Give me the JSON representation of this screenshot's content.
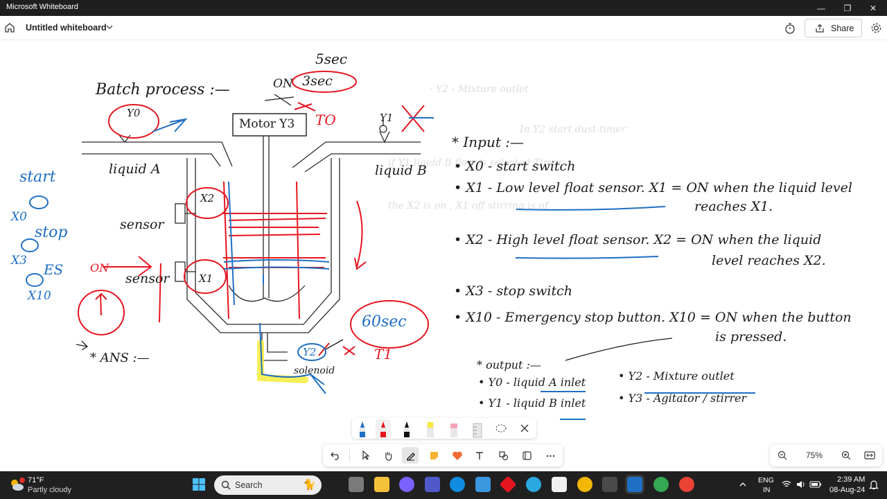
{
  "window": {
    "title": "Microsoft Whiteboard",
    "minimize_glyph": "—",
    "maximize_glyph": "❐",
    "close_glyph": "✕"
  },
  "header": {
    "doc_title": "Untitled whiteboard",
    "share_label": "Share"
  },
  "board": {
    "heading": "Batch process :—",
    "timer_top": "5sec",
    "timer_on": "ON",
    "timer_mid": "3sec",
    "motor_box": "Motor Y3",
    "to_label": "TO",
    "valve_a_tag": "Y0",
    "valve_b_tag": "Y1",
    "liquid_a": "liquid A",
    "liquid_b": "liquid B",
    "sensor_top": "sensor",
    "sensor_bottom": "sensor",
    "x2_tag": "X2",
    "x1_tag": "X1",
    "on_label": "ON",
    "y2_tag": "Y2",
    "solenoid": "solenoid",
    "timer_60": "60sec",
    "t1_label": "T1",
    "ans": "* ANS :—",
    "start_label": "start",
    "x0_label": "X0",
    "stop_label": "stop",
    "x3_label": "X3",
    "es_label": "ES",
    "x10_label": "X10",
    "input_heading": "* Input :—",
    "inputs": [
      "• X0 - start switch",
      "• X1 - Low level float sensor. X1 = ON when the liquid level",
      "reaches X1.",
      "• X2 - High level float sensor. X2 = ON when the liquid",
      "level reaches X2.",
      "• X3 - stop switch",
      "• X10 - Emergency stop button. X10 = ON when the button",
      "is pressed."
    ],
    "output_heading": "* output :—",
    "outputs": [
      "• Y0 - liquid A inlet",
      "• Y2 - Mixture outlet",
      "• Y1 - liquid B inlet",
      "• Y3 - Agitator / stirrer"
    ]
  },
  "zoom": {
    "level": "75%"
  },
  "taskbar": {
    "weather_temp": "71°F",
    "weather_condition": "Partly cloudy",
    "search_placeholder": "Search",
    "lang_1": "ENG",
    "lang_2": "IN",
    "time": "2:39 AM",
    "date": "08-Aug-24"
  },
  "colors": {
    "ink": "#1b1b1b",
    "red": "#e5151f",
    "blue": "#1f6fc4",
    "yellow": "#f6ec3c"
  }
}
